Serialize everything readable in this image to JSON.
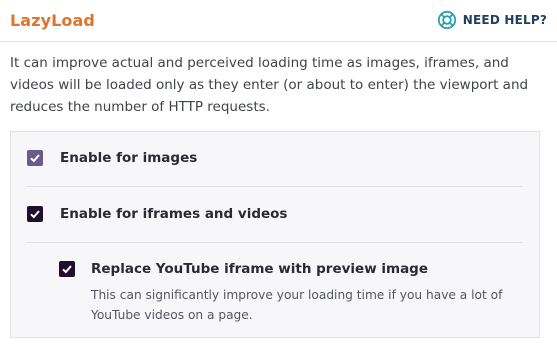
{
  "header": {
    "title": "LazyLoad",
    "help_label": "NEED HELP?",
    "help_icon": "lifebuoy-icon"
  },
  "description": "It can improve actual and perceived loading time as images, iframes, and videos will be loaded only as they enter (or about to enter) the viewport and reduces the number of HTTP requests.",
  "options": [
    {
      "label": "Enable for images",
      "checked": true,
      "color": "#6a5b8c"
    },
    {
      "label": "Enable for iframes and videos",
      "checked": true,
      "color": "#1f0f2e"
    }
  ],
  "sub_option": {
    "label": "Replace YouTube iframe with preview image",
    "checked": true,
    "color": "#1f0f2e",
    "description": "This can significantly improve your loading time if you have a lot of YouTube videos on a page."
  },
  "colors": {
    "title": "#e0742f",
    "help": "#1f3f5b",
    "help_icon": "#2d9fb3",
    "panel_bg": "#f7f6f8"
  }
}
